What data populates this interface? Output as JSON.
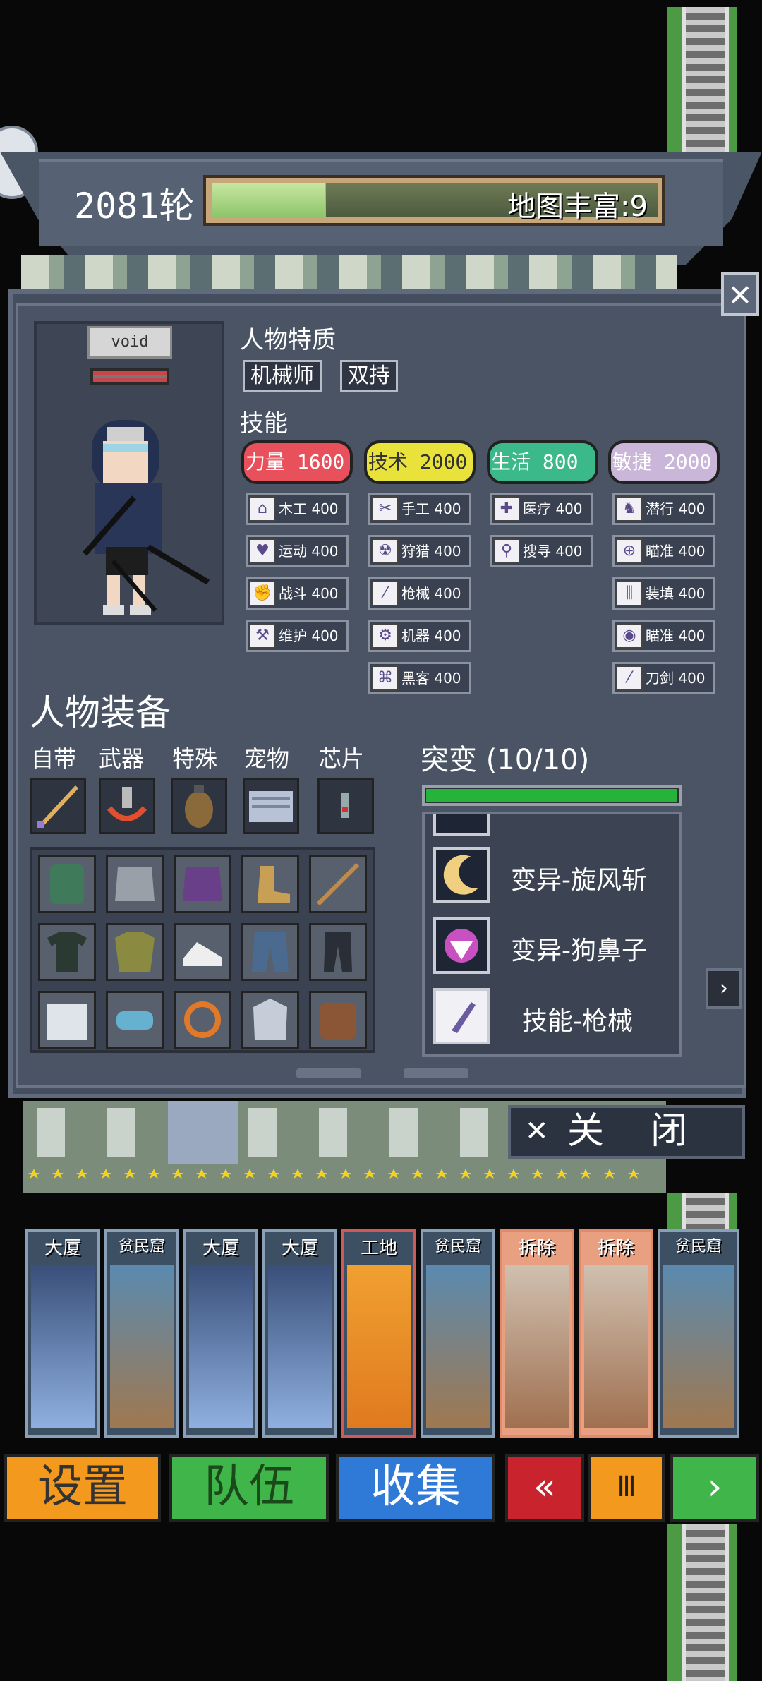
{
  "header": {
    "round": "2081轮",
    "map_wealth": "地图丰富:9"
  },
  "character": {
    "name": "void"
  },
  "traits": {
    "title": "人物特质",
    "items": [
      "机械师",
      "双持"
    ]
  },
  "skills": {
    "title": "技能",
    "categories": [
      {
        "label": "力量 1600",
        "color": "#e8505b"
      },
      {
        "label": "技术 2000",
        "color": "#e8e23a"
      },
      {
        "label": "生活 800",
        "color": "#3cb98a"
      },
      {
        "label": "敏捷 2000",
        "color": "#c9b6d8"
      }
    ],
    "strength": [
      "木工 400",
      "运动 400",
      "战斗 400",
      "维护 400"
    ],
    "tech": [
      "手工 400",
      "狩猎 400",
      "枪械 400",
      "机器 400",
      "黑客 400"
    ],
    "life": [
      "医疗 400",
      "搜寻 400"
    ],
    "agility": [
      "潜行 400",
      "瞄准 400",
      "装填 400",
      "瞄准 400",
      "刀剑 400"
    ]
  },
  "equipment": {
    "title": "人物装备",
    "slots": [
      "自带",
      "武器",
      "特殊",
      "宠物",
      "芯片"
    ]
  },
  "mutations": {
    "title": "突变 (10/10)",
    "progress": 1.0,
    "items": [
      "变异-旋风斩",
      "变异-狗鼻子",
      "技能-枪械"
    ]
  },
  "close_label": "关    闭",
  "cards": [
    "大厦",
    "贫民窟",
    "大厦",
    "大厦",
    "工地",
    "贫民窟",
    "拆除",
    "拆除",
    "贫民窟"
  ],
  "bottom_buttons": {
    "settings": "设置",
    "team": "队伍",
    "collect": "收集",
    "rewind": "«",
    "pause": "Ⅲ",
    "next": "›"
  },
  "colors": {
    "settings": "#f39a1e",
    "team": "#3fb54a",
    "collect": "#2f7ad6",
    "rewind": "#c9232e",
    "pause": "#f39a1e",
    "next": "#3fb54a"
  }
}
